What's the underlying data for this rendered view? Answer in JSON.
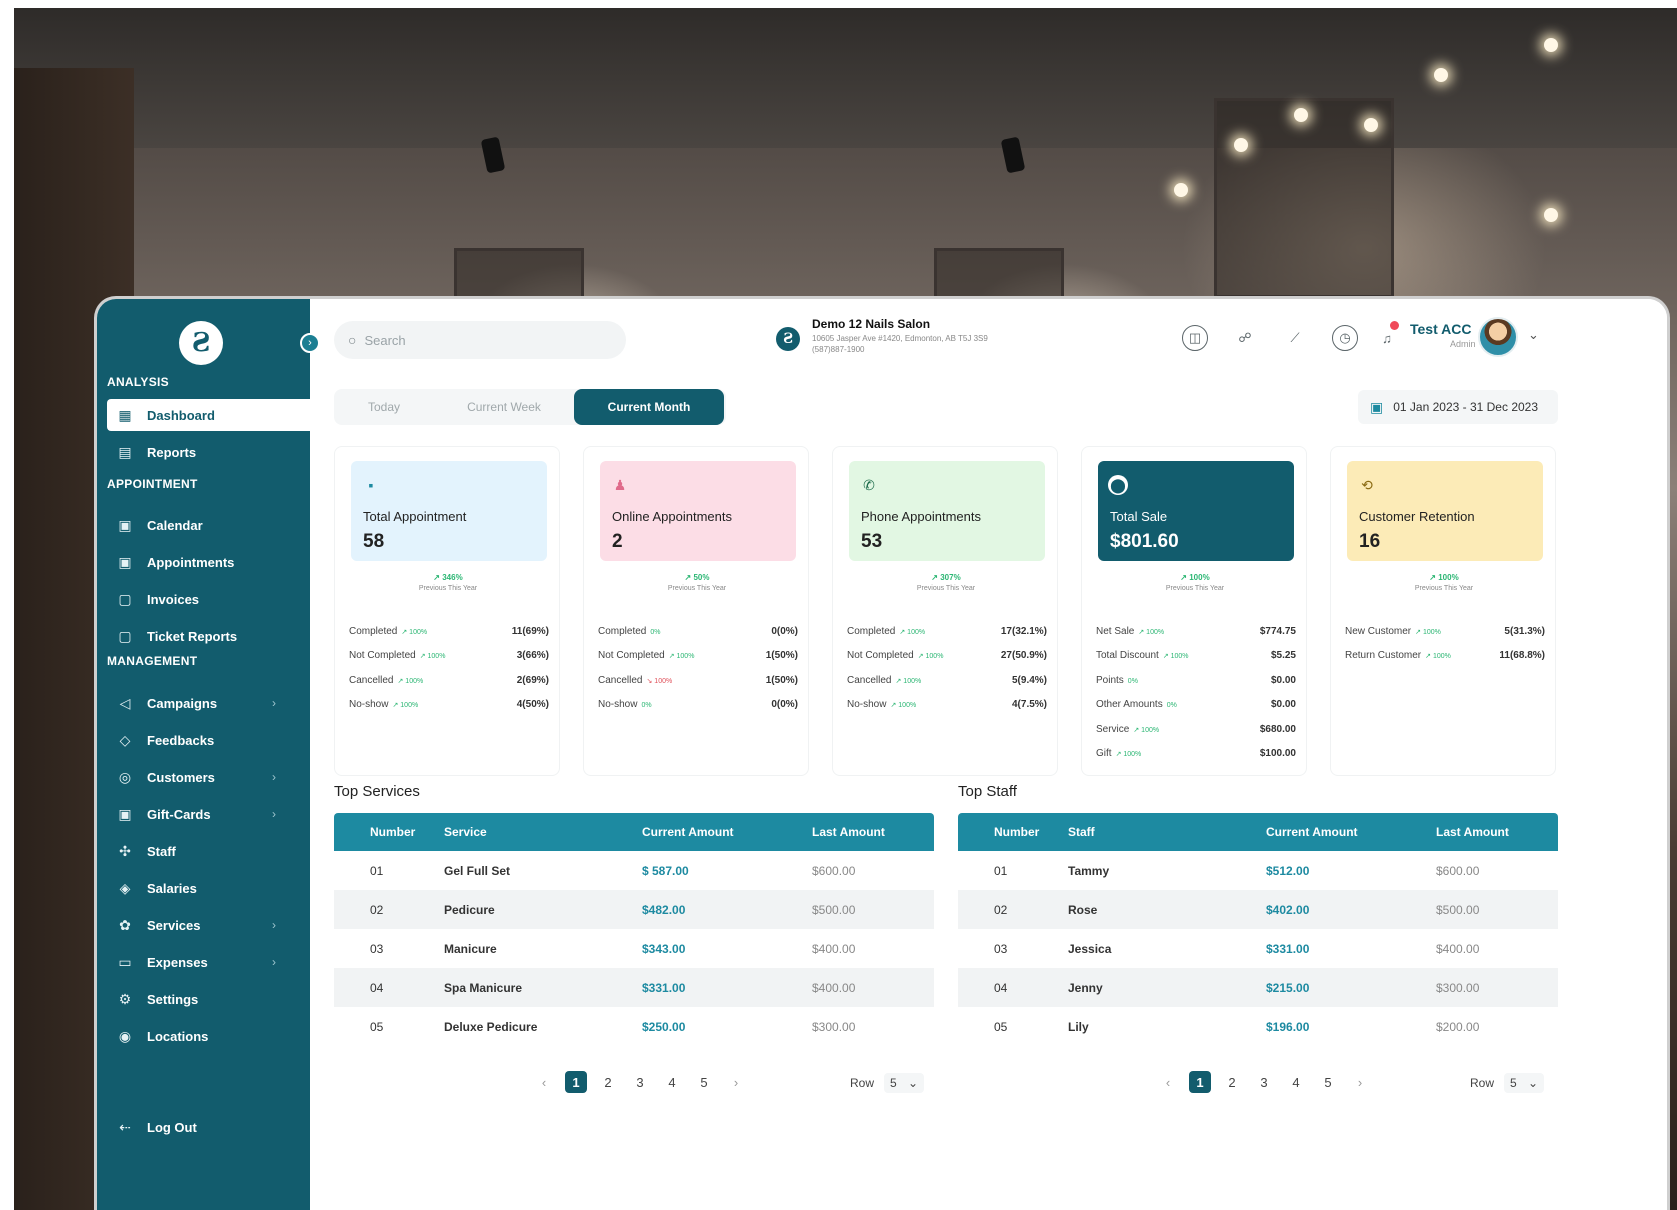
{
  "search": {
    "placeholder": "Search"
  },
  "salon": {
    "name": "Demo 12 Nails Salon",
    "address": "10605 Jasper Ave #1420, Edmonton, AB T5J 3S9",
    "phone": "(587)887-1900"
  },
  "user": {
    "name": "Test ACC",
    "role": "Admin"
  },
  "sidebar": {
    "sections": {
      "analysis": "ANALYSIS",
      "appointment": "APPOINTMENT",
      "management": "MANAGEMENT"
    },
    "items": [
      {
        "label": "Dashboard",
        "icon": "dashboard-icon",
        "glyph": "▦"
      },
      {
        "label": "Reports",
        "icon": "reports-icon",
        "glyph": "▤"
      },
      {
        "label": "Calendar",
        "icon": "calendar-icon",
        "glyph": "▣"
      },
      {
        "label": "Appointments",
        "icon": "appointments-icon",
        "glyph": "▣"
      },
      {
        "label": "Invoices",
        "icon": "invoices-icon",
        "glyph": "▢"
      },
      {
        "label": "Ticket Reports",
        "icon": "ticket-icon",
        "glyph": "▢"
      },
      {
        "label": "Campaigns",
        "icon": "megaphone-icon",
        "glyph": "◁"
      },
      {
        "label": "Feedbacks",
        "icon": "feedback-icon",
        "glyph": "◇"
      },
      {
        "label": "Customers",
        "icon": "customers-icon",
        "glyph": "◎"
      },
      {
        "label": "Gift-Cards",
        "icon": "gift-card-icon",
        "glyph": "▣"
      },
      {
        "label": "Staff",
        "icon": "staff-icon",
        "glyph": "✣"
      },
      {
        "label": "Salaries",
        "icon": "salaries-icon",
        "glyph": "◈"
      },
      {
        "label": "Services",
        "icon": "services-icon",
        "glyph": "✿"
      },
      {
        "label": "Expenses",
        "icon": "expenses-icon",
        "glyph": "▭"
      },
      {
        "label": "Settings",
        "icon": "gear-icon",
        "glyph": "⚙"
      },
      {
        "label": "Locations",
        "icon": "location-icon",
        "glyph": "◉"
      }
    ],
    "logout": "Log Out"
  },
  "tabs": [
    "Today",
    "Current Week",
    "Current Month"
  ],
  "date_range": "01 Jan 2023 - 31 Dec 2023",
  "cards": [
    {
      "label": "Total Appointment",
      "value": "58",
      "trend": "↗ 346%",
      "trend_sub": "Previous This Year",
      "bg": "#e3f3fd",
      "icon_color": "#1d8aa1",
      "glyph": "▪",
      "rows": [
        {
          "label": "Completed",
          "pct": "↗ 100%",
          "value": "11(69%)"
        },
        {
          "label": "Not Completed",
          "pct": "↗ 100%",
          "value": "3(66%)"
        },
        {
          "label": "Cancelled",
          "pct": "↗ 100%",
          "value": "2(69%)"
        },
        {
          "label": "No-show",
          "pct": "↗ 100%",
          "value": "4(50%)"
        }
      ]
    },
    {
      "label": "Online Appointments",
      "value": "2",
      "trend": "↗ 50%",
      "trend_sub": "Previous This Year",
      "bg": "#fcdde6",
      "icon_color": "#e06a8b",
      "glyph": "♟",
      "rows": [
        {
          "label": "Completed",
          "pct": "0%",
          "value": "0(0%)"
        },
        {
          "label": "Not Completed",
          "pct": "↗ 100%",
          "value": "1(50%)"
        },
        {
          "label": "Cancelled",
          "pct": "↘ 100%",
          "value": "1(50%)",
          "neg": true
        },
        {
          "label": "No-show",
          "pct": "0%",
          "value": "0(0%)"
        }
      ]
    },
    {
      "label": "Phone Appointments",
      "value": "53",
      "trend": "↗ 307%",
      "trend_sub": "Previous This Year",
      "bg": "#e2f7e3",
      "icon_color": "#1b6b4a",
      "glyph": "✆",
      "rows": [
        {
          "label": "Completed",
          "pct": "↗ 100%",
          "value": "17(32.1%)"
        },
        {
          "label": "Not Completed",
          "pct": "↗ 100%",
          "value": "27(50.9%)"
        },
        {
          "label": "Cancelled",
          "pct": "↗ 100%",
          "value": "5(9.4%)"
        },
        {
          "label": "No-show",
          "pct": "↗ 100%",
          "value": "4(7.5%)"
        }
      ]
    },
    {
      "label": "Total Sale",
      "value": "$801.60",
      "trend": "↗ 100%",
      "trend_sub": "Previous This Year",
      "bg": "#125c6d",
      "icon_color": "#ffffff",
      "glyph": "⬤",
      "dark": true,
      "rows": [
        {
          "label": "Net Sale",
          "pct": "↗ 100%",
          "value": "$774.75"
        },
        {
          "label": "Total Discount",
          "pct": "↗ 100%",
          "value": "$5.25"
        },
        {
          "label": "Points",
          "pct": "0%",
          "value": "$0.00"
        },
        {
          "label": "Other Amounts",
          "pct": "0%",
          "value": "$0.00"
        },
        {
          "label": "Service",
          "pct": "↗ 100%",
          "value": "$680.00"
        },
        {
          "label": "Gift",
          "pct": "↗ 100%",
          "value": "$100.00"
        }
      ]
    },
    {
      "label": "Customer Retention",
      "value": "16",
      "trend": "↗ 100%",
      "trend_sub": "Previous This Year",
      "bg": "#fcebb7",
      "icon_color": "#8a6a12",
      "glyph": "⟲",
      "rows": [
        {
          "label": "New Customer",
          "pct": "↗ 100%",
          "value": "5(31.3%)"
        },
        {
          "label": "Return Customer",
          "pct": "↗ 100%",
          "value": "11(68.8%)"
        }
      ]
    }
  ],
  "top_services": {
    "title": "Top Services",
    "headers": [
      "Number",
      "Service",
      "Current Amount",
      "Last Amount"
    ],
    "rows": [
      [
        "01",
        "Gel Full Set",
        "$ 587.00",
        "$600.00"
      ],
      [
        "02",
        "Pedicure",
        "$482.00",
        "$500.00"
      ],
      [
        "03",
        "Manicure",
        "$343.00",
        "$400.00"
      ],
      [
        "04",
        "Spa Manicure",
        "$331.00",
        "$400.00"
      ],
      [
        "05",
        "Deluxe Pedicure",
        "$250.00",
        "$300.00"
      ]
    ],
    "pages": [
      "1",
      "2",
      "3",
      "4",
      "5"
    ],
    "row_label": "Row",
    "row_value": "5"
  },
  "top_staff": {
    "title": "Top Staff",
    "headers": [
      "Number",
      "Staff",
      "Current Amount",
      "Last Amount"
    ],
    "rows": [
      [
        "01",
        "Tammy",
        "$512.00",
        "$600.00"
      ],
      [
        "02",
        "Rose",
        "$402.00",
        "$500.00"
      ],
      [
        "03",
        "Jessica",
        "$331.00",
        "$400.00"
      ],
      [
        "04",
        "Jenny",
        "$215.00",
        "$300.00"
      ],
      [
        "05",
        "Lily",
        "$196.00",
        "$200.00"
      ]
    ],
    "pages": [
      "1",
      "2",
      "3",
      "4",
      "5"
    ],
    "row_label": "Row",
    "row_value": "5"
  },
  "colors": {
    "primary": "#125c6d",
    "accent": "#1d8aa1",
    "positive": "#2bb673",
    "negative": "#e0505a"
  }
}
